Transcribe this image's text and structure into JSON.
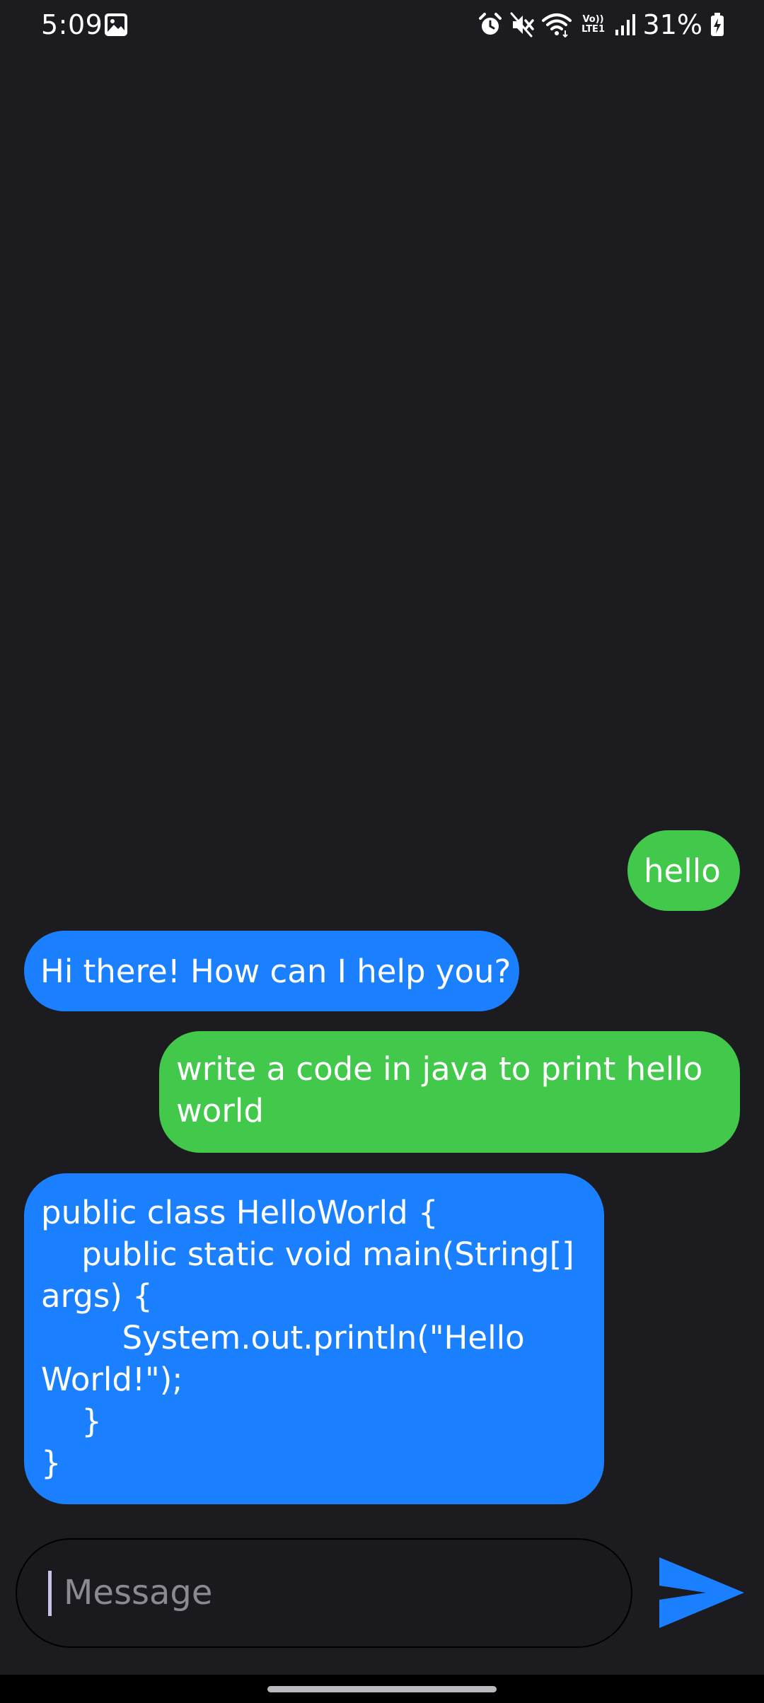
{
  "status_bar": {
    "time": "5:09",
    "battery": "31%",
    "network_label_top": "Vo))",
    "network_label_bottom": "LTE1",
    "icons": [
      "gallery-icon",
      "alarm-icon",
      "mute-icon",
      "wifi-icon",
      "signal-icon",
      "battery-charging-icon"
    ]
  },
  "messages": [
    {
      "sender": "user",
      "text": "hello"
    },
    {
      "sender": "bot",
      "text": "Hi there! How can I help you?"
    },
    {
      "sender": "user",
      "text": "write a code in java to print hello\nworld"
    },
    {
      "sender": "bot",
      "text": "public class HelloWorld {\n    public static void main(String[]\nargs) {\n        System.out.println(\"Hello\nWorld!\");\n    }\n}"
    }
  ],
  "composer": {
    "placeholder": "Message",
    "value": "",
    "send_icon": "send-icon"
  },
  "colors": {
    "background": "#1c1c20",
    "user_bubble": "#42c84b",
    "bot_bubble": "#1a80ff",
    "send_icon": "#1a80ff"
  }
}
